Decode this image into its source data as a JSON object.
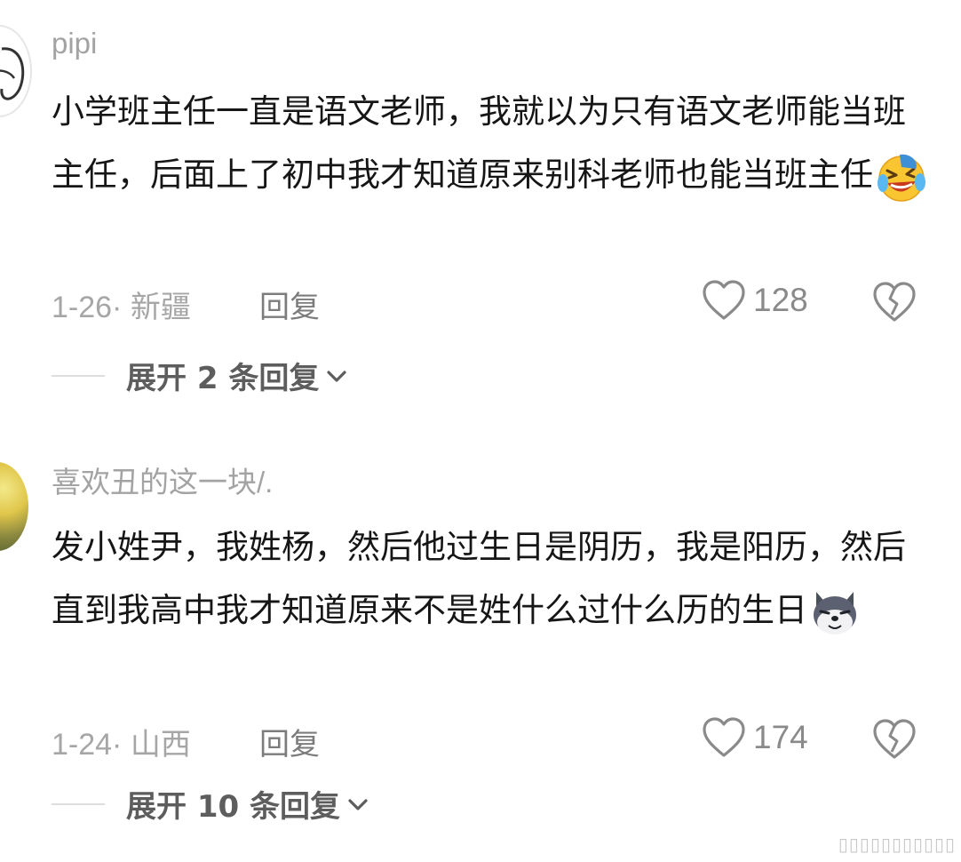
{
  "comments": [
    {
      "username": "pipi",
      "text": "小学班主任一直是语文老师，我就以为只有语文老师能当班主任，后面上了初中我才知道原来别科老师也能当班主任",
      "emoji_icon": "laughing-crying-emoji-icon",
      "meta": "1-26· 新疆",
      "reply_label": "回复",
      "likes": "128",
      "expand_label": "展开 2 条回复"
    },
    {
      "username": "喜欢丑的这一块/.",
      "text": "发小姓尹，我姓杨，然后他过生日是阴历，我是阳历，然后直到我高中我才知道原来不是姓什么过什么历的生日",
      "emoji_icon": "husky-dog-emoji-icon",
      "meta": "1-24· 山西",
      "reply_label": "回复",
      "likes": "174",
      "expand_label": "展开 10 条回复"
    }
  ],
  "colors": {
    "text": "#161616",
    "muted": "#a6a6a6",
    "icon": "#8a8a8a"
  },
  "watermark": "▯▯▯▯▯▯▯▯▯▯▯"
}
